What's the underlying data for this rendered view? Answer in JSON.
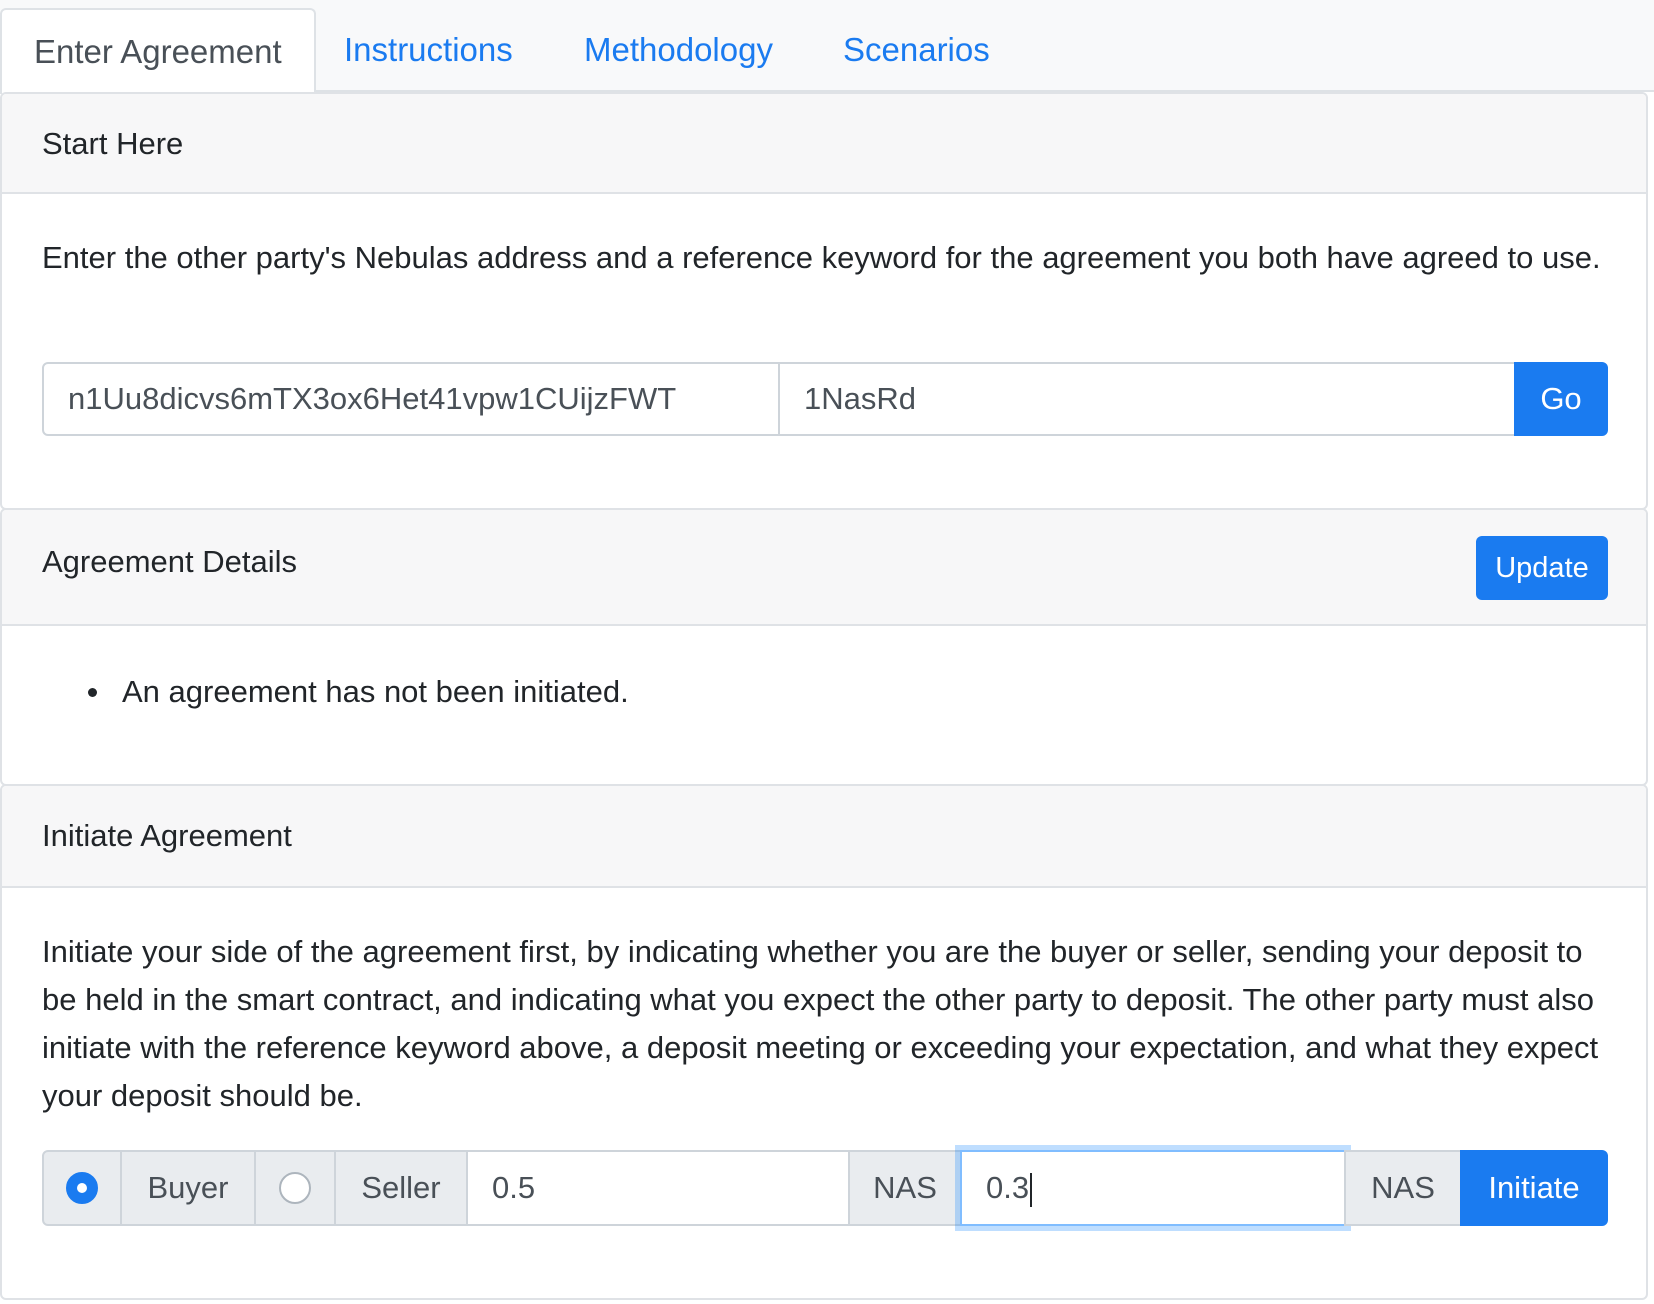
{
  "tabs": [
    {
      "label": "Enter Agreement",
      "active": true
    },
    {
      "label": "Instructions"
    },
    {
      "label": "Methodology"
    },
    {
      "label": "Scenarios"
    }
  ],
  "start": {
    "title": "Start Here",
    "description": "Enter the other party's Nebulas address and a reference keyword for the agreement you both have agreed to use.",
    "address_value": "n1Uu8dicvs6mTX3ox6Het41vpw1CUijzFWT",
    "keyword_value": "1NasRd",
    "go_label": "Go"
  },
  "details": {
    "title": "Agreement Details",
    "update_label": "Update",
    "items": [
      "An agreement has not been initiated."
    ]
  },
  "initiate": {
    "title": "Initiate Agreement",
    "description": "Initiate your side of the agreement first, by indicating whether you are the buyer or seller, sending your deposit to be held in the smart contract, and indicating what you expect the other party to deposit. The other party must also initiate with the reference keyword above, a deposit meeting or exceeding your expectation, and what they expect your deposit should be.",
    "buyer_label": "Buyer",
    "seller_label": "Seller",
    "selected_role": "Buyer",
    "deposit_value": "0.5",
    "deposit_unit": "NAS",
    "expected_value": "0.3",
    "expected_unit": "NAS",
    "initiate_label": "Initiate"
  },
  "colors": {
    "primary": "#1a7bf0",
    "header_bg": "#f7f7f8",
    "addon_bg": "#e9ecef"
  }
}
